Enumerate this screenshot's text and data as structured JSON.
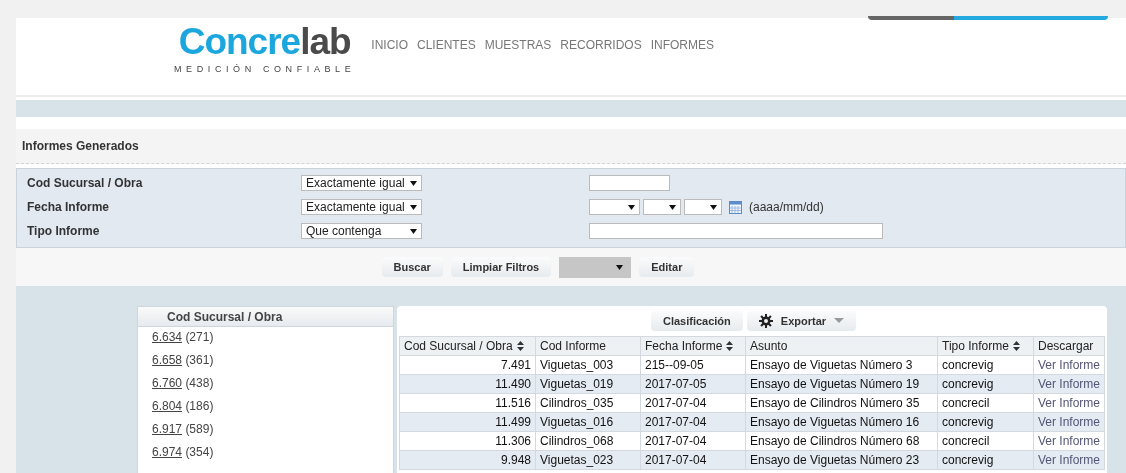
{
  "logo": {
    "part_1": "Concre",
    "part_2": "lab",
    "tagline": "MEDICIÓN CONFIABLE"
  },
  "nav": [
    "INICIO",
    "CLIENTES",
    "MUESTRAS",
    "RECORRIDOS",
    "INFORMES"
  ],
  "section_title": "Informes Generados",
  "filters": [
    {
      "kind": "text",
      "label": "Cod Sucursal / Obra",
      "operator": "Exactamente igual"
    },
    {
      "kind": "date",
      "label": "Fecha Informe",
      "operator": "Exactamente igual",
      "hint": "(aaaa/mm/dd)"
    },
    {
      "kind": "wide",
      "label": "Tipo Informe",
      "operator": "Que contenga"
    }
  ],
  "actions": [
    {
      "kind": "button",
      "label": "Buscar"
    },
    {
      "kind": "button",
      "label": "Limpiar Filtros"
    },
    {
      "kind": "dropdown"
    },
    {
      "kind": "button",
      "label": "Editar"
    }
  ],
  "side_panel": {
    "title": "Cod Sucursal / Obra",
    "items": [
      {
        "code": "6.634",
        "count": "(271)"
      },
      {
        "code": "6.658",
        "count": "(361)"
      },
      {
        "code": "6.760",
        "count": "(438)"
      },
      {
        "code": "6.804",
        "count": "(186)"
      },
      {
        "code": "6.917",
        "count": "(589)"
      },
      {
        "code": "6.974",
        "count": "(354)"
      }
    ]
  },
  "toolbar": {
    "classify": "Clasificación",
    "export": "Exportar"
  },
  "table": {
    "columns": [
      {
        "label": "Cod Sucursal / Obra",
        "sortable": true
      },
      {
        "label": "Cod Informe",
        "sortable": false
      },
      {
        "label": "Fecha Informe",
        "sortable": true
      },
      {
        "label": "Asunto",
        "sortable": false
      },
      {
        "label": "Tipo Informe",
        "sortable": true
      },
      {
        "label": "Descargar",
        "sortable": false
      }
    ],
    "rows": [
      [
        "7.491",
        "Viguetas_003",
        "215--09-05",
        "Ensayo de Viguetas Número 3",
        "concrevig",
        "Ver Informe"
      ],
      [
        "11.490",
        "Viguetas_019",
        "2017-07-05",
        "Ensayo de Viguetas Número 19",
        "concrevig",
        "Ver Informe"
      ],
      [
        "11.516",
        "Cilindros_035",
        "2017-07-04",
        "Ensayo de Cilindros Número 35",
        "concrecil",
        "Ver Informe"
      ],
      [
        "11.499",
        "Viguetas_016",
        "2017-07-04",
        "Ensayo de Viguetas Número 16",
        "concrevig",
        "Ver Informe"
      ],
      [
        "11.306",
        "Cilindros_068",
        "2017-07-04",
        "Ensayo de Cilindros Número 68",
        "concrecil",
        "Ver Informe"
      ],
      [
        "9.948",
        "Viguetas_023",
        "2017-07-04",
        "Ensayo de Viguetas Número 23",
        "concrevig",
        "Ver Informe"
      ]
    ]
  }
}
